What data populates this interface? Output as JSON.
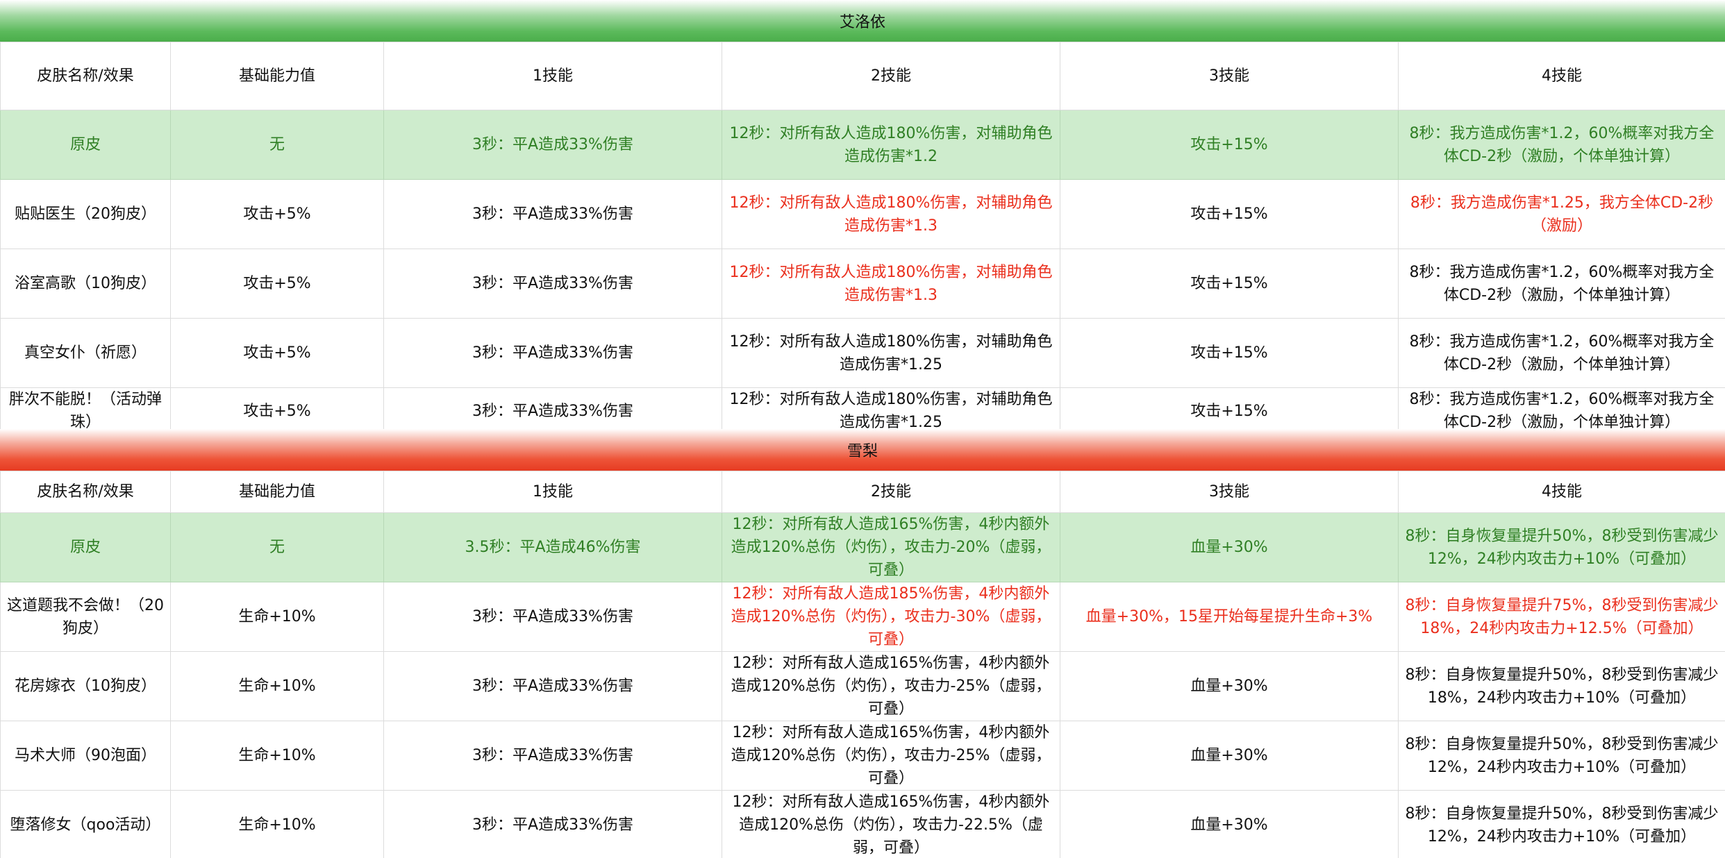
{
  "columns": [
    "皮肤名称/效果",
    "基础能力值",
    "1技能",
    "2技能",
    "3技能",
    "4技能"
  ],
  "sections": [
    {
      "title": "艾洛依",
      "rows": [
        {
          "name": "原皮",
          "base": "无",
          "s1": "3秒：平A造成33%伤害",
          "s2": "12秒：对所有敌人造成180%伤害，对辅助角色造成伤害*1.2",
          "s3": "攻击+15%",
          "s4": "8秒：我方造成伤害*1.2，60%概率对我方全体CD-2秒（激励，个体单独计算）"
        },
        {
          "name": "贴贴医生（20狗皮）",
          "base": "攻击+5%",
          "s1": "3秒：平A造成33%伤害",
          "s2": "12秒：对所有敌人造成180%伤害，对辅助角色造成伤害*1.3",
          "s3": "攻击+15%",
          "s4": "8秒：我方造成伤害*1.25，我方全体CD-2秒（激励）"
        },
        {
          "name": "浴室高歌（10狗皮）",
          "base": "攻击+5%",
          "s1": "3秒：平A造成33%伤害",
          "s2": "12秒：对所有敌人造成180%伤害，对辅助角色造成伤害*1.3",
          "s3": "攻击+15%",
          "s4": "8秒：我方造成伤害*1.2，60%概率对我方全体CD-2秒（激励，个体单独计算）"
        },
        {
          "name": "真空女仆（祈愿）",
          "base": "攻击+5%",
          "s1": "3秒：平A造成33%伤害",
          "s2": "12秒：对所有敌人造成180%伤害，对辅助角色造成伤害*1.25",
          "s3": "攻击+15%",
          "s4": "8秒：我方造成伤害*1.2，60%概率对我方全体CD-2秒（激励，个体单独计算）"
        },
        {
          "name": "胖次不能脱！（活动弹珠）",
          "base": "攻击+5%",
          "s1": "3秒：平A造成33%伤害",
          "s2": "12秒：对所有敌人造成180%伤害，对辅助角色造成伤害*1.25",
          "s3": "攻击+15%",
          "s4": "8秒：我方造成伤害*1.2，60%概率对我方全体CD-2秒（激励，个体单独计算）"
        }
      ]
    },
    {
      "title": "雪梨",
      "rows": [
        {
          "name": "原皮",
          "base": "无",
          "s1": "3.5秒：平A造成46%伤害",
          "s2": "12秒：对所有敌人造成165%伤害，4秒内额外造成120%总伤（灼伤），攻击力-20%（虚弱，可叠）",
          "s3": "血量+30%",
          "s4": "8秒：自身恢复量提升50%，8秒受到伤害减少12%，24秒内攻击力+10%（可叠加）"
        },
        {
          "name": "这道题我不会做！（20狗皮）",
          "base": "生命+10%",
          "s1": "3秒：平A造成33%伤害",
          "s2": "12秒：对所有敌人造成185%伤害，4秒内额外造成120%总伤（灼伤），攻击力-30%（虚弱，可叠）",
          "s3": "血量+30%，15星开始每星提升生命+3%",
          "s4": "8秒：自身恢复量提升75%，8秒受到伤害减少18%，24秒内攻击力+12.5%（可叠加）"
        },
        {
          "name": "花房嫁衣（10狗皮）",
          "base": "生命+10%",
          "s1": "3秒：平A造成33%伤害",
          "s2": "12秒：对所有敌人造成165%伤害，4秒内额外造成120%总伤（灼伤），攻击力-25%（虚弱，可叠）",
          "s3": "血量+30%",
          "s4": "8秒：自身恢复量提升50%，8秒受到伤害减少18%，24秒内攻击力+10%（可叠加）"
        },
        {
          "name": "马术大师（90泡面）",
          "base": "生命+10%",
          "s1": "3秒：平A造成33%伤害",
          "s2": "12秒：对所有敌人造成165%伤害，4秒内额外造成120%总伤（灼伤），攻击力-25%（虚弱，可叠）",
          "s3": "血量+30%",
          "s4": "8秒：自身恢复量提升50%，8秒受到伤害减少12%，24秒内攻击力+10%（可叠加）"
        },
        {
          "name": "堕落修女（qoo活动）",
          "base": "生命+10%",
          "s1": "3秒：平A造成33%伤害",
          "s2": "12秒：对所有敌人造成165%伤害，4秒内额外造成120%总伤（灼伤），攻击力-22.5%（虚弱，可叠）",
          "s3": "血量+30%",
          "s4": "8秒：自身恢复量提升50%，8秒受到伤害减少12%，24秒内攻击力+10%（可叠加）"
        }
      ]
    }
  ],
  "colors": {
    "base_row_bg": "#ceeccd",
    "base_row_text": "#2f7f24",
    "highlight_text": "#ea2f1d",
    "banner_green": "#4aae4a",
    "banner_red": "#e63b22"
  }
}
